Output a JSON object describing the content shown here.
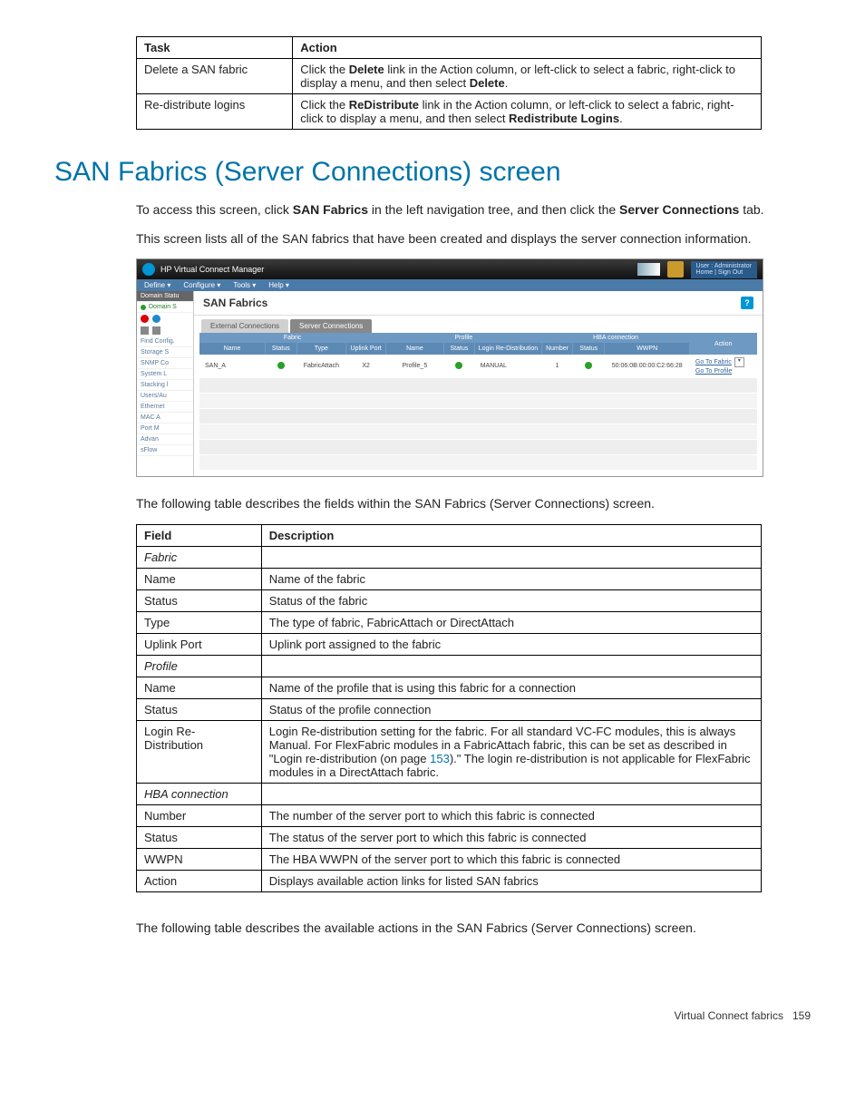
{
  "table1": {
    "headers": [
      "Task",
      "Action"
    ],
    "rows": [
      {
        "task": "Delete a SAN fabric",
        "action_pre": "Click the ",
        "action_b1": "Delete",
        "action_mid": " link in the Action column, or left-click to select a fabric, right-click to display a menu, and then select ",
        "action_b2": "Delete",
        "action_post": "."
      },
      {
        "task": "Re-distribute logins",
        "action_pre": "Click the ",
        "action_b1": "ReDistribute",
        "action_mid": " link in the Action column, or left-click to select a fabric, right-click to display a menu, and then select ",
        "action_b2": "Redistribute Logins",
        "action_post": "."
      }
    ]
  },
  "section_heading": "SAN Fabrics (Server Connections) screen",
  "para1": {
    "pre": "To access this screen, click ",
    "b1": "SAN Fabrics",
    "mid": " in the left navigation tree, and then click the ",
    "b2": "Server Connections",
    "post": " tab."
  },
  "para2": "This screen lists all of the SAN fabrics that have been created and displays the server connection information.",
  "screenshot": {
    "app_title": "HP Virtual Connect Manager",
    "user_line1": "User : Administrator",
    "user_line2": "Home | Sign Out",
    "menubar": [
      "Define ▾",
      "Configure ▾",
      "Tools ▾",
      "Help ▾"
    ],
    "sidebar": {
      "hdr": "Domain Statu",
      "row_green": "Domain S",
      "items": [
        "Find Config.",
        "Storage S",
        "SNMP Co",
        "System L",
        "Stacking l",
        "Users/Au",
        "Ethernet",
        "MAC A",
        "Port M",
        "Advan",
        "sFlow"
      ]
    },
    "page_title": "SAN Fabrics",
    "tabs": [
      "External Connections",
      "Server Connections"
    ],
    "grid": {
      "groups": [
        "Fabric",
        "Profile",
        "HBA connection",
        ""
      ],
      "headers": [
        "Name",
        "Status",
        "Type",
        "Uplink Port",
        "Name",
        "Status",
        "Login Re-Distribution",
        "Number",
        "Status",
        "WWPN",
        "Action"
      ],
      "row": {
        "fabric_name": "SAN_A",
        "type": "FabricAttach",
        "uplink": "X2",
        "profile_name": "Profile_5",
        "login_redist": "MANUAL",
        "number": "1",
        "wwpn": "50:06:0B:00:00:C2:66:28",
        "action1": "Go To Fabric",
        "action2": "Go To Profile"
      }
    }
  },
  "para3": "The following table describes the fields within the SAN Fabrics (Server Connections) screen.",
  "table2": {
    "headers": [
      "Field",
      "Description"
    ],
    "rows": [
      {
        "field": "Fabric",
        "desc": "",
        "italic": true
      },
      {
        "field": "Name",
        "desc": "Name of the fabric"
      },
      {
        "field": "Status",
        "desc": "Status of the fabric"
      },
      {
        "field": "Type",
        "desc": "The type of fabric, FabricAttach or DirectAttach"
      },
      {
        "field": "Uplink Port",
        "desc": "Uplink port assigned to the fabric"
      },
      {
        "field": "Profile",
        "desc": "",
        "italic": true
      },
      {
        "field": "Name",
        "desc": "Name of the profile that is using this fabric for a connection"
      },
      {
        "field": "Status",
        "desc": "Status of the profile connection"
      },
      {
        "field": "Login Re-Distribution",
        "desc_pre": "Login Re-distribution setting for the fabric. For all standard VC-FC modules, this is always Manual. For FlexFabric modules in a FabricAttach fabric, this can be set as described in \"Login re-distribution (on page ",
        "link": "153",
        "desc_post": ").\" The login re-distribution is not applicable for FlexFabric modules in a DirectAttach fabric."
      },
      {
        "field": "HBA connection",
        "desc": "",
        "italic": true
      },
      {
        "field": "Number",
        "desc": "The number of the server port to which this fabric is connected"
      },
      {
        "field": "Status",
        "desc": "The status of the server port to which this fabric is connected"
      },
      {
        "field": "WWPN",
        "desc": "The HBA WWPN of the server port to which this fabric is connected"
      },
      {
        "field": "Action",
        "desc": "Displays available action links for listed SAN fabrics"
      }
    ]
  },
  "para4": "The following table describes the available actions in the SAN Fabrics (Server Connections) screen.",
  "footer": {
    "label": "Virtual Connect fabrics",
    "page": "159"
  }
}
